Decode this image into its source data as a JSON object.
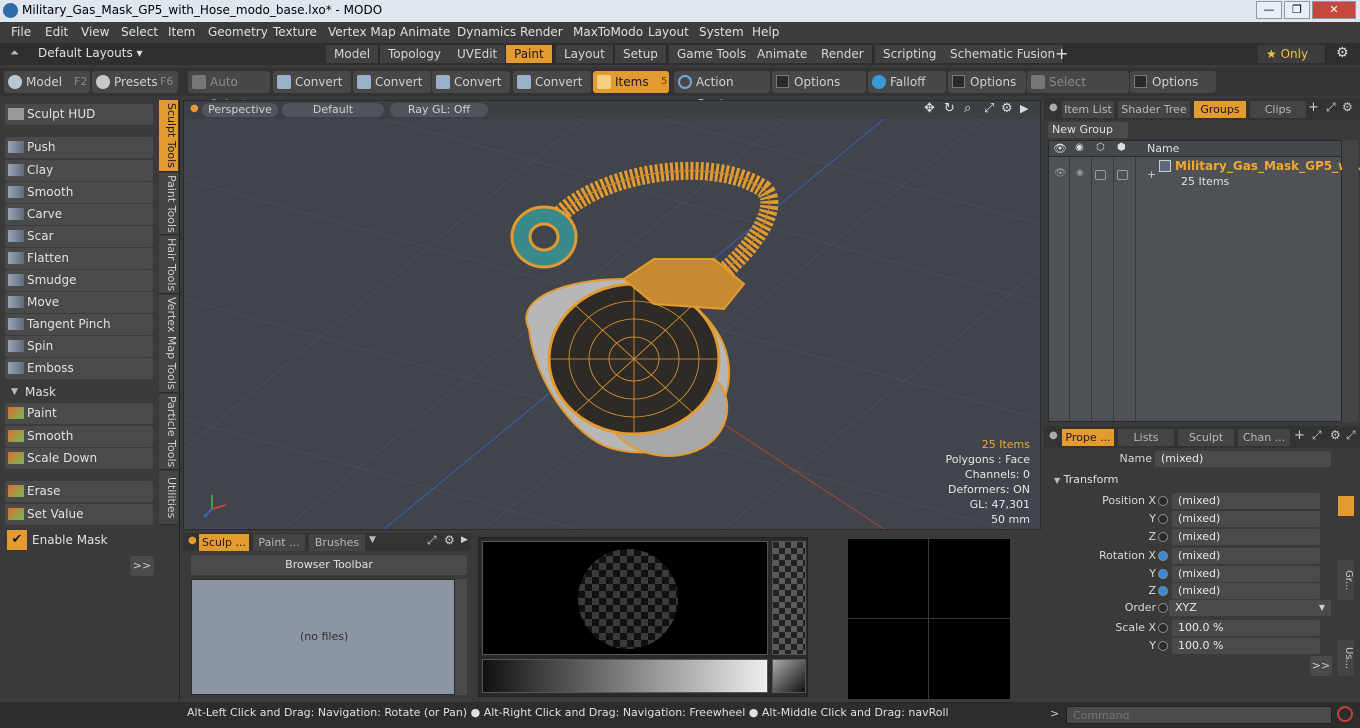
{
  "window": {
    "title": "Military_Gas_Mask_GP5_with_Hose_modo_base.lxo* - MODO",
    "minimize": "—",
    "maximize": "❐",
    "close": "✕"
  },
  "menu": [
    "File",
    "Edit",
    "View",
    "Select",
    "Item",
    "Geometry",
    "Texture",
    "Vertex Map",
    "Animate",
    "Dynamics",
    "Render",
    "MaxToModo",
    "Layout",
    "System",
    "Help"
  ],
  "layoutbar": {
    "layouts_label": "Default Layouts ▾",
    "tabs": [
      "Model",
      "Topology",
      "UVEdit",
      "Paint",
      "Layout",
      "Setup",
      "Game Tools",
      "Animate",
      "Render",
      "Scripting",
      "Schematic Fusion"
    ],
    "active_tab": "Paint",
    "add": "+",
    "only_label": "★  Only"
  },
  "toolbar": {
    "model": "Model",
    "model_key": "F2",
    "presets": "Presets",
    "presets_key": "F6",
    "auto_select": "Auto Select",
    "convert1": "Convert",
    "convert2": "Convert",
    "convert3": "Convert",
    "convert4": "Convert",
    "items": "Items",
    "items_key": "5",
    "action_center": "Action Center",
    "options1": "Options",
    "falloff": "Falloff",
    "options2": "Options",
    "select_through": "Select Through",
    "options3": "Options"
  },
  "sculpt": {
    "hud": "Sculpt HUD",
    "tools": [
      "Push",
      "Clay",
      "Smooth",
      "Carve",
      "Scar",
      "Flatten",
      "Smudge",
      "Move",
      "Tangent Pinch",
      "Spin",
      "Emboss"
    ],
    "mask_header": "Mask",
    "mask_tools": [
      "Paint",
      "Smooth",
      "Scale Down"
    ],
    "erase": "Erase",
    "set_value": "Set Value",
    "enable_mask": "Enable Mask",
    "expand": ">>"
  },
  "vtabs": [
    "Sculpt Tools",
    "Paint Tools",
    "Hair Tools",
    "Vertex Map Tools",
    "Particle Tools",
    "Utilities"
  ],
  "viewport": {
    "view": "Perspective",
    "shading": "Default",
    "raygl": "Ray GL: Off",
    "stats": {
      "items": "25 Items",
      "polygons": "Polygons : Face",
      "channels": "Channels: 0",
      "deformers": "Deformers: ON",
      "gl": "GL: 47,301",
      "scale": "50 mm"
    }
  },
  "bottom": {
    "tabs": [
      "Sculp ...",
      "Paint ...",
      "Brushes"
    ],
    "browser_toolbar": "Browser Toolbar",
    "no_files": "(no files)"
  },
  "itemlist": {
    "tabs": [
      "Item List",
      "Shader Tree",
      "Groups",
      "Clips"
    ],
    "active_tab": "Groups",
    "new_group": "New Group",
    "col_name": "Name",
    "group_name": "Military_Gas_Mask_GP5_w...",
    "group_count": "25 Items"
  },
  "properties": {
    "tabs": [
      "Prope ...",
      "Lists",
      "Sculpt",
      "Chan ..."
    ],
    "name_label": "Name",
    "name_value": "(mixed)",
    "transform_header": "Transform",
    "rows": [
      {
        "label": "Position X",
        "value": "(mixed)"
      },
      {
        "label": "Y",
        "value": "(mixed)"
      },
      {
        "label": "Z",
        "value": "(mixed)"
      },
      {
        "label": "Rotation X",
        "value": "(mixed)"
      },
      {
        "label": "Y",
        "value": "(mixed)"
      },
      {
        "label": "Z",
        "value": "(mixed)"
      },
      {
        "label": "Order",
        "value": "XYZ"
      },
      {
        "label": "Scale X",
        "value": "100.0 %"
      },
      {
        "label": "Y",
        "value": "100.0 %"
      }
    ],
    "expand": ">>",
    "side_tabs": [
      "Gr...",
      "Us..."
    ]
  },
  "status": {
    "message": "Alt-Left Click and Drag: Navigation: Rotate (or Pan) ● Alt-Right Click and Drag: Navigation: Freewheel ● Alt-Middle Click and Drag: navRoll",
    "command_placeholder": "Command"
  }
}
